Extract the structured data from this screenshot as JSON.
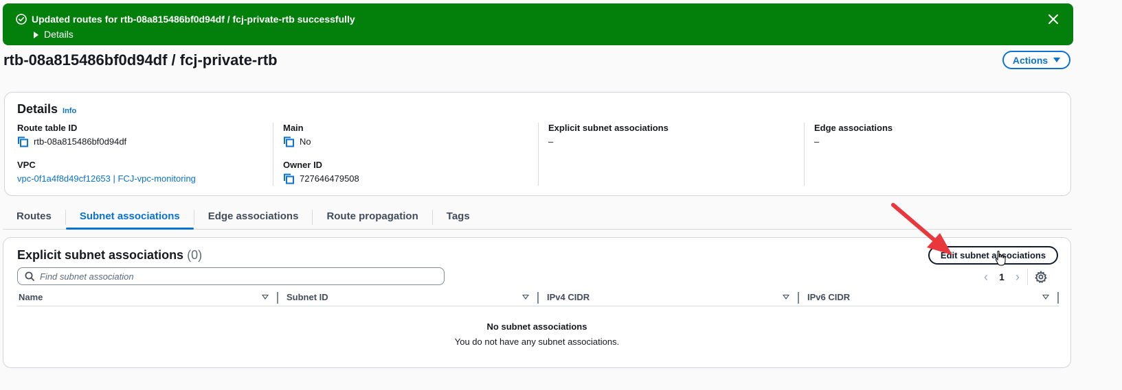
{
  "flash": {
    "message": "Updated routes for rtb-08a815486bf0d94df / fcj-private-rtb successfully",
    "details_label": "Details",
    "color": "#037f0c"
  },
  "page": {
    "title": "rtb-08a815486bf0d94df / fcj-private-rtb",
    "actions_label": "Actions"
  },
  "details": {
    "heading": "Details",
    "info_label": "Info",
    "route_table_id_label": "Route table ID",
    "route_table_id": "rtb-08a815486bf0d94df",
    "vpc_label": "VPC",
    "vpc_value": "vpc-0f1a4f8d49cf12653 | FCJ-vpc-monitoring",
    "main_label": "Main",
    "main_value": "No",
    "owner_label": "Owner ID",
    "owner_value": "727646479508",
    "explicit_label": "Explicit subnet associations",
    "explicit_value": "–",
    "edge_label": "Edge associations",
    "edge_value": "–"
  },
  "tabs": [
    {
      "label": "Routes",
      "active": false
    },
    {
      "label": "Subnet associations",
      "active": true
    },
    {
      "label": "Edge associations",
      "active": false
    },
    {
      "label": "Route propagation",
      "active": false
    },
    {
      "label": "Tags",
      "active": false
    }
  ],
  "assoc": {
    "title": "Explicit subnet associations",
    "count": "(0)",
    "edit_label": "Edit subnet associations",
    "search_placeholder": "Find subnet association",
    "page_number": "1",
    "columns": [
      "Name",
      "Subnet ID",
      "IPv4 CIDR",
      "IPv6 CIDR"
    ],
    "empty_heading": "No subnet associations",
    "empty_text": "You do not have any subnet associations."
  },
  "colors": {
    "accent": "#0972d3",
    "annotation_arrow": "#e8383d"
  },
  "icons": [
    "check-circle-icon",
    "caret-right-icon",
    "close-icon",
    "caret-down-icon",
    "copy-icon",
    "search-icon",
    "chevron-left-icon",
    "chevron-right-icon",
    "gear-icon",
    "sort-icon",
    "annotation-arrow",
    "hand-cursor-icon"
  ]
}
